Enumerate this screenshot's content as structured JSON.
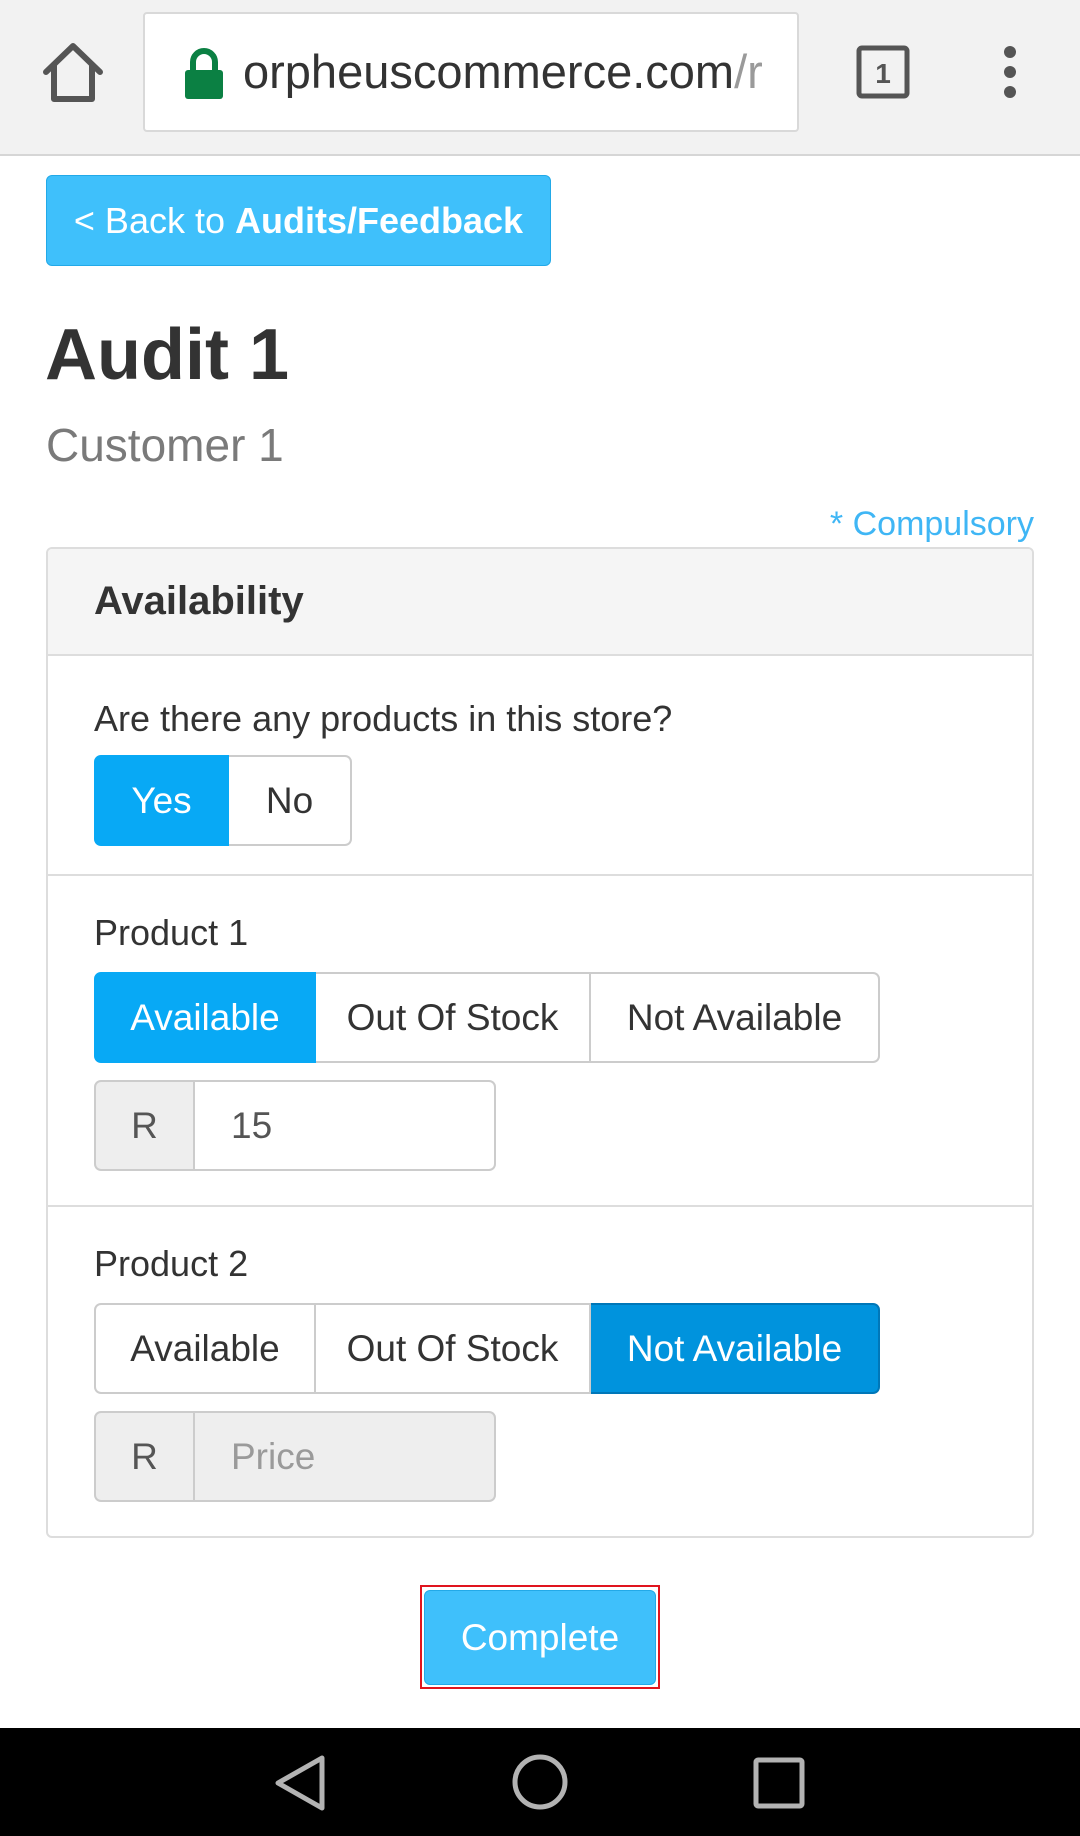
{
  "browser": {
    "url_visible": "orpheuscommerce.com",
    "url_faded": "/r",
    "tab_count": "1"
  },
  "page": {
    "back_button": {
      "prefix": "< Back to ",
      "target": "Audits/Feedback"
    },
    "title": "Audit 1",
    "subtitle": "Customer 1",
    "compulsory_note": "* Compulsory"
  },
  "panel": {
    "title": "Availability",
    "question": {
      "label": "Are there any products in this store?",
      "options": [
        "Yes",
        "No"
      ],
      "selected": "Yes"
    },
    "products": [
      {
        "label": "Product 1",
        "options": [
          "Available",
          "Out Of Stock",
          "Not Available"
        ],
        "selected": "Available",
        "currency": "R",
        "price_value": "15",
        "price_placeholder": "Price"
      },
      {
        "label": "Product 2",
        "options": [
          "Available",
          "Out Of Stock",
          "Not Available"
        ],
        "selected": "Not Available",
        "currency": "R",
        "price_value": "",
        "price_placeholder": "Price"
      }
    ]
  },
  "actions": {
    "complete_label": "Complete"
  },
  "colors": {
    "accent": "#3fc0fb",
    "selected": "#08a9f5",
    "compulsory": "#3fb6f5",
    "focus_outline": "#e0141e"
  }
}
